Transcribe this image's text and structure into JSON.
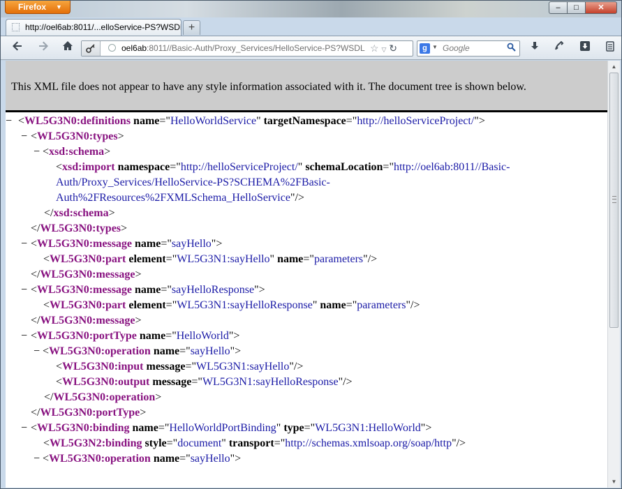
{
  "browser": {
    "menu_button": "Firefox",
    "tab_title": "http://oel6ab:8011/...elloService-PS?WSDL",
    "new_tab": "+",
    "url_host": "oel6ab",
    "url_rest": ":8011//Basic-Auth/Proxy_Services/HelloService-PS?WSDL",
    "search_engine_badge": "g",
    "search_placeholder": "Google",
    "window_controls": {
      "minimize": "–",
      "maximize": "□",
      "close": "✕"
    }
  },
  "icons": [
    "back-icon",
    "forward-icon",
    "home-icon",
    "key-icon",
    "globe-icon",
    "star-icon",
    "dropmarker-icon",
    "reload-icon",
    "search-icon",
    "download-arrow-icon",
    "puzzle-icon",
    "download-box-icon",
    "menu-icon"
  ],
  "page": {
    "notice": "This XML file does not appear to have any style information associated with it. The document tree is shown below."
  },
  "xml_lines": [
    {
      "fold": "−",
      "parts": [
        [
          "p",
          "<"
        ],
        [
          "t",
          "WL5G3N0:definitions"
        ],
        [
          "p",
          " "
        ],
        [
          "a",
          "name"
        ],
        [
          "p",
          "=\""
        ],
        [
          "v",
          "HelloWorldService"
        ],
        [
          "p",
          "\" "
        ],
        [
          "a",
          "targetNamespace"
        ],
        [
          "p",
          "=\""
        ],
        [
          "v",
          "http://helloServiceProject/"
        ],
        [
          "p",
          "\">"
        ]
      ]
    },
    {
      "fold": "−",
      "parts": [
        [
          "p",
          "<"
        ],
        [
          "t",
          "WL5G3N0:types"
        ],
        [
          "p",
          ">"
        ]
      ]
    },
    {
      "fold": "−",
      "parts": [
        [
          "p",
          "<"
        ],
        [
          "t",
          "xsd:schema"
        ],
        [
          "p",
          ">"
        ]
      ]
    },
    {
      "fold": "",
      "parts": [
        [
          "p",
          "<"
        ],
        [
          "t",
          "xsd:import"
        ],
        [
          "p",
          " "
        ],
        [
          "a",
          "namespace"
        ],
        [
          "p",
          "=\""
        ],
        [
          "v",
          "http://helloServiceProject/"
        ],
        [
          "p",
          "\" "
        ],
        [
          "a",
          "schemaLocation"
        ],
        [
          "p",
          "=\""
        ],
        [
          "v",
          "http://oel6ab:8011//Basic-"
        ]
      ]
    },
    {
      "fold": "",
      "parts": [
        [
          "v",
          "Auth/Proxy_Services/HelloService-PS?SCHEMA%2FBasic-"
        ]
      ]
    },
    {
      "fold": "",
      "parts": [
        [
          "v",
          "Auth%2FResources%2FXMLSchema_HelloService"
        ],
        [
          "p",
          "\"/>"
        ]
      ]
    },
    {
      "fold": "",
      "parts": [
        [
          "p",
          "</"
        ],
        [
          "t",
          "xsd:schema"
        ],
        [
          "p",
          ">"
        ]
      ]
    },
    {
      "fold": "",
      "parts": [
        [
          "p",
          "</"
        ],
        [
          "t",
          "WL5G3N0:types"
        ],
        [
          "p",
          ">"
        ]
      ]
    },
    {
      "fold": "−",
      "parts": [
        [
          "p",
          "<"
        ],
        [
          "t",
          "WL5G3N0:message"
        ],
        [
          "p",
          " "
        ],
        [
          "a",
          "name"
        ],
        [
          "p",
          "=\""
        ],
        [
          "v",
          "sayHello"
        ],
        [
          "p",
          "\">"
        ]
      ]
    },
    {
      "fold": "",
      "parts": [
        [
          "p",
          "<"
        ],
        [
          "t",
          "WL5G3N0:part"
        ],
        [
          "p",
          " "
        ],
        [
          "a",
          "element"
        ],
        [
          "p",
          "=\""
        ],
        [
          "v",
          "WL5G3N1:sayHello"
        ],
        [
          "p",
          "\" "
        ],
        [
          "a",
          "name"
        ],
        [
          "p",
          "=\""
        ],
        [
          "v",
          "parameters"
        ],
        [
          "p",
          "\"/>"
        ]
      ]
    },
    {
      "fold": "",
      "parts": [
        [
          "p",
          "</"
        ],
        [
          "t",
          "WL5G3N0:message"
        ],
        [
          "p",
          ">"
        ]
      ]
    },
    {
      "fold": "−",
      "parts": [
        [
          "p",
          "<"
        ],
        [
          "t",
          "WL5G3N0:message"
        ],
        [
          "p",
          " "
        ],
        [
          "a",
          "name"
        ],
        [
          "p",
          "=\""
        ],
        [
          "v",
          "sayHelloResponse"
        ],
        [
          "p",
          "\">"
        ]
      ]
    },
    {
      "fold": "",
      "parts": [
        [
          "p",
          "<"
        ],
        [
          "t",
          "WL5G3N0:part"
        ],
        [
          "p",
          " "
        ],
        [
          "a",
          "element"
        ],
        [
          "p",
          "=\""
        ],
        [
          "v",
          "WL5G3N1:sayHelloResponse"
        ],
        [
          "p",
          "\" "
        ],
        [
          "a",
          "name"
        ],
        [
          "p",
          "=\""
        ],
        [
          "v",
          "parameters"
        ],
        [
          "p",
          "\"/>"
        ]
      ]
    },
    {
      "fold": "",
      "parts": [
        [
          "p",
          "</"
        ],
        [
          "t",
          "WL5G3N0:message"
        ],
        [
          "p",
          ">"
        ]
      ]
    },
    {
      "fold": "−",
      "parts": [
        [
          "p",
          "<"
        ],
        [
          "t",
          "WL5G3N0:portType"
        ],
        [
          "p",
          " "
        ],
        [
          "a",
          "name"
        ],
        [
          "p",
          "=\""
        ],
        [
          "v",
          "HelloWorld"
        ],
        [
          "p",
          "\">"
        ]
      ]
    },
    {
      "fold": "−",
      "parts": [
        [
          "p",
          "<"
        ],
        [
          "t",
          "WL5G3N0:operation"
        ],
        [
          "p",
          " "
        ],
        [
          "a",
          "name"
        ],
        [
          "p",
          "=\""
        ],
        [
          "v",
          "sayHello"
        ],
        [
          "p",
          "\">"
        ]
      ]
    },
    {
      "fold": "",
      "parts": [
        [
          "p",
          "<"
        ],
        [
          "t",
          "WL5G3N0:input"
        ],
        [
          "p",
          " "
        ],
        [
          "a",
          "message"
        ],
        [
          "p",
          "=\""
        ],
        [
          "v",
          "WL5G3N1:sayHello"
        ],
        [
          "p",
          "\"/>"
        ]
      ]
    },
    {
      "fold": "",
      "parts": [
        [
          "p",
          "<"
        ],
        [
          "t",
          "WL5G3N0:output"
        ],
        [
          "p",
          " "
        ],
        [
          "a",
          "message"
        ],
        [
          "p",
          "=\""
        ],
        [
          "v",
          "WL5G3N1:sayHelloResponse"
        ],
        [
          "p",
          "\"/>"
        ]
      ]
    },
    {
      "fold": "",
      "parts": [
        [
          "p",
          "</"
        ],
        [
          "t",
          "WL5G3N0:operation"
        ],
        [
          "p",
          ">"
        ]
      ]
    },
    {
      "fold": "",
      "parts": [
        [
          "p",
          "</"
        ],
        [
          "t",
          "WL5G3N0:portType"
        ],
        [
          "p",
          ">"
        ]
      ]
    },
    {
      "fold": "−",
      "parts": [
        [
          "p",
          "<"
        ],
        [
          "t",
          "WL5G3N0:binding"
        ],
        [
          "p",
          " "
        ],
        [
          "a",
          "name"
        ],
        [
          "p",
          "=\""
        ],
        [
          "v",
          "HelloWorldPortBinding"
        ],
        [
          "p",
          "\" "
        ],
        [
          "a",
          "type"
        ],
        [
          "p",
          "=\""
        ],
        [
          "v",
          "WL5G3N1:HelloWorld"
        ],
        [
          "p",
          "\">"
        ]
      ]
    },
    {
      "fold": "",
      "parts": [
        [
          "p",
          "<"
        ],
        [
          "t",
          "WL5G3N2:binding"
        ],
        [
          "p",
          " "
        ],
        [
          "a",
          "style"
        ],
        [
          "p",
          "=\""
        ],
        [
          "v",
          "document"
        ],
        [
          "p",
          "\" "
        ],
        [
          "a",
          "transport"
        ],
        [
          "p",
          "=\""
        ],
        [
          "v",
          "http://schemas.xmlsoap.org/soap/http"
        ],
        [
          "p",
          "\"/>"
        ]
      ]
    },
    {
      "fold": "−",
      "parts": [
        [
          "p",
          "<"
        ],
        [
          "t",
          "WL5G3N0:operation"
        ],
        [
          "p",
          " "
        ],
        [
          "a",
          "name"
        ],
        [
          "p",
          "=\""
        ],
        [
          "v",
          "sayHello"
        ],
        [
          "p",
          "\">"
        ]
      ]
    }
  ]
}
